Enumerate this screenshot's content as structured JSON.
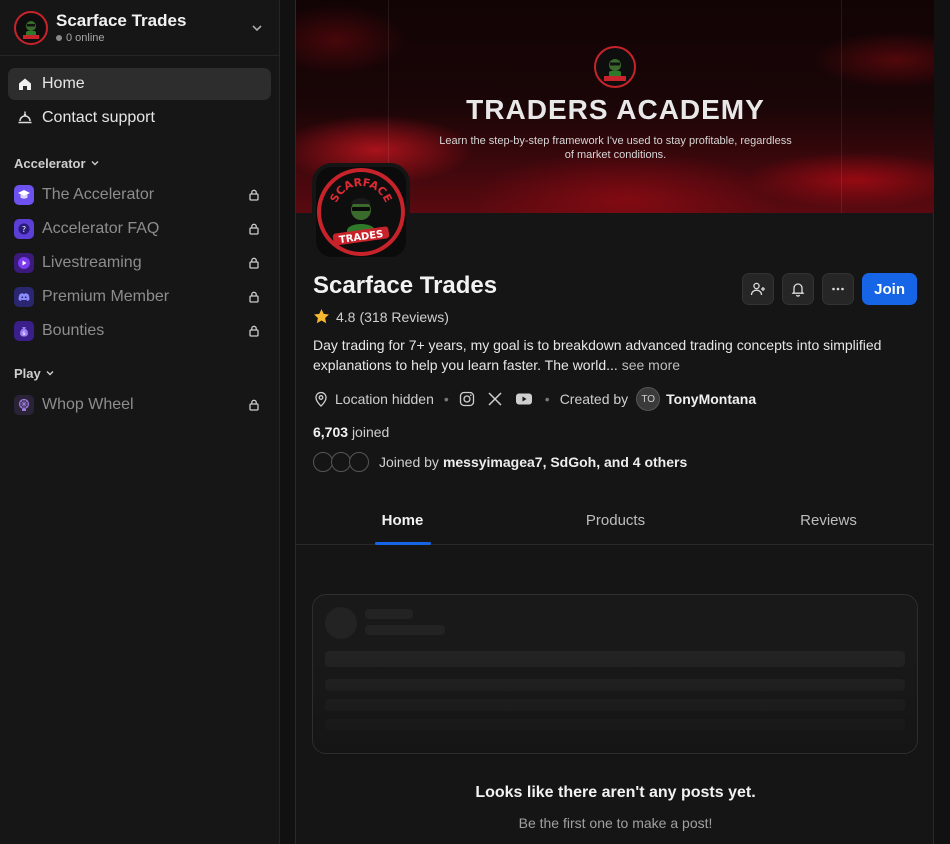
{
  "workspace": {
    "name": "Scarface Trades",
    "online": "0 online"
  },
  "nav": [
    {
      "label": "Home",
      "icon": "home-icon",
      "active": true
    },
    {
      "label": "Contact support",
      "icon": "support-bell-icon",
      "active": false
    }
  ],
  "sections": [
    {
      "label": "Accelerator",
      "items": [
        {
          "label": "The Accelerator",
          "icon": "graduation-cap-icon",
          "color": "#6d52f0"
        },
        {
          "label": "Accelerator FAQ",
          "icon": "question-icon",
          "color": "#5b3fd6"
        },
        {
          "label": "Livestreaming",
          "icon": "play-icon",
          "color": "#6d2fd8"
        },
        {
          "label": "Premium Member",
          "icon": "discord-icon",
          "color": "#4f46c8"
        },
        {
          "label": "Bounties",
          "icon": "money-bag-icon",
          "color": "#5a35d0"
        }
      ]
    },
    {
      "label": "Play",
      "items": [
        {
          "label": "Whop Wheel",
          "icon": "wheel-icon",
          "color": "#8a6ad0"
        }
      ]
    }
  ],
  "banner": {
    "title": "TRADERS ACADEMY",
    "subtitle": "Learn the step-by-step framework I've used to stay profitable, regardless of market conditions."
  },
  "logo_text": {
    "top": "SCARFACE",
    "bottom": "TRADES"
  },
  "profile": {
    "name": "Scarface Trades",
    "rating": "4.8",
    "reviews": "(318 Reviews)",
    "description": "Day trading for 7+ years, my goal is to breakdown advanced trading concepts into simplified explanations to help you learn faster. The world...",
    "see_more": "see more",
    "location": "Location hidden",
    "created_by_label": "Created by",
    "creator_initials": "TO",
    "creator_name": "TonyMontana",
    "joined_count": "6,703",
    "joined_label": "joined",
    "joined_by_prefix": "Joined by",
    "joined_by_names": "messyimagea7, SdGoh, and 4 others",
    "join_label": "Join"
  },
  "tabs": [
    "Home",
    "Products",
    "Reviews"
  ],
  "empty": {
    "title": "Looks like there aren't any posts yet.",
    "subtitle": "Be the first one to make a post!"
  },
  "colors": {
    "accent": "#1665e6",
    "brand_red": "#c8232b",
    "star": "#f5b82e"
  }
}
